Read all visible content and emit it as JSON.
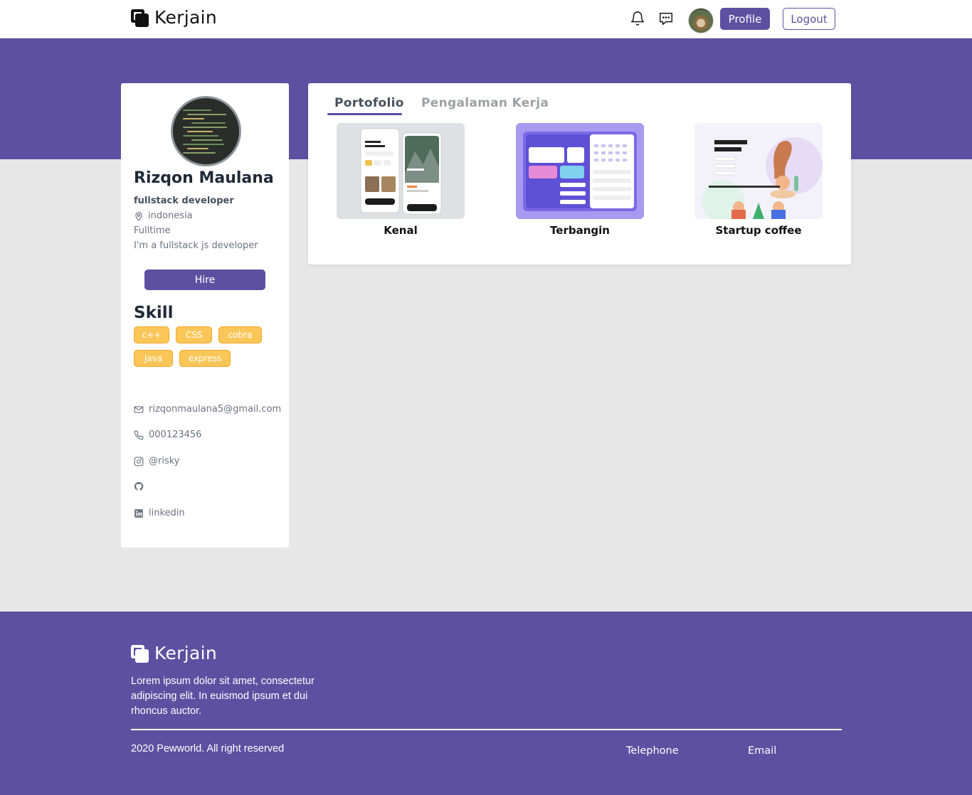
{
  "navbar": {
    "brand": "Kerjain",
    "profile_label": "Profile",
    "logout_label": "Logout"
  },
  "profile": {
    "name": "Rizqon Maulana",
    "role": "fullstack developer",
    "location": "indonesia",
    "job_type": "Fulltime",
    "bio": "I'm a fullstack js developer",
    "hire_label": "Hire",
    "skill_title": "Skill",
    "skills": [
      "c++",
      "CSS",
      "cobra",
      "Java",
      "express"
    ],
    "contacts": {
      "email": "rizqonmaulana5@gmail.com",
      "phone": "000123456",
      "instagram": "@risky",
      "github": "",
      "linkedin": "linkedin"
    }
  },
  "portfolio": {
    "tabs": [
      "Portofolio",
      "Pengalaman Kerja"
    ],
    "active_tab": "Portofolio",
    "items": [
      {
        "title": "Kenal"
      },
      {
        "title": "Terbangin"
      },
      {
        "title": "Startup coffee"
      }
    ]
  },
  "footer": {
    "brand": "Kerjain",
    "description": "Lorem ipsum dolor sit amet, consectetur adipiscing elit. In euismod ipsum et dui rhoncus auctor.",
    "copyright": "2020 Pewworld. All right reserved",
    "links": [
      "Telephone",
      "Email"
    ]
  },
  "colors": {
    "brand_purple": "#5e50a1",
    "skill_badge": "#fbc658",
    "page_background": "#e7e7e7"
  }
}
